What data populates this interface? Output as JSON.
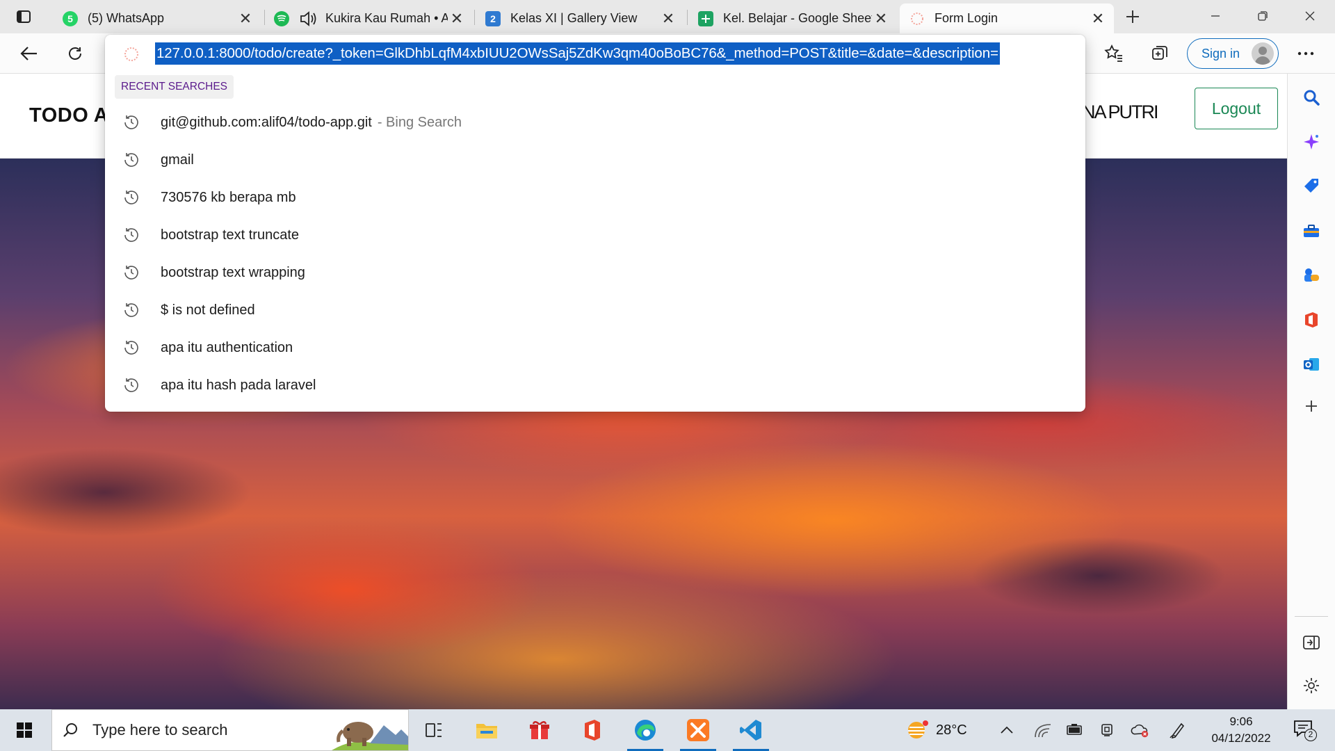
{
  "browser": {
    "tabs": [
      {
        "title": "(5) WhatsApp",
        "favicon": "whatsapp-icon",
        "badge": "5",
        "color": "#25d366"
      },
      {
        "title": "Kukira Kau Rumah • Amig",
        "favicon": "spotify-icon",
        "color": "#1db954"
      },
      {
        "title": "Kelas XI | Gallery View",
        "favicon": "number-two-icon",
        "badge": "2",
        "color": "#2f7ad1"
      },
      {
        "title": "Kel. Belajar - Google Sheets",
        "favicon": "google-sheets-icon",
        "color": "#1ea362"
      },
      {
        "title": "Form Login",
        "favicon": "laravel-icon",
        "color": "#f05340"
      }
    ],
    "active_tab_index": 4,
    "signin_label": "Sign in"
  },
  "omnibox": {
    "url": "127.0.0.1:8000/todo/create?_token=GlkDhbLqfM4xbIUU2OWsSaj5ZdKw3qm40oBoBC76&_method=POST&title=&date=&description=",
    "recent_label": "RECENT SEARCHES",
    "suggestions": [
      {
        "text": "git@github.com:alif04/todo-app.git",
        "sub": "- Bing Search"
      },
      {
        "text": "gmail",
        "sub": ""
      },
      {
        "text": "730576 kb berapa mb",
        "sub": ""
      },
      {
        "text": "bootstrap text truncate",
        "sub": ""
      },
      {
        "text": "bootstrap text wrapping",
        "sub": ""
      },
      {
        "text": "$ is not defined",
        "sub": ""
      },
      {
        "text": "apa itu authentication",
        "sub": ""
      },
      {
        "text": "apa itu hash pada laravel",
        "sub": ""
      }
    ]
  },
  "page": {
    "brand": "TODO APP",
    "username": "NA PUTRI",
    "logout_label": "Logout"
  },
  "taskbar": {
    "search_placeholder": "Type here to search",
    "weather": "28°C",
    "time": "9:06",
    "date": "04/12/2022",
    "notification_count": "2"
  }
}
